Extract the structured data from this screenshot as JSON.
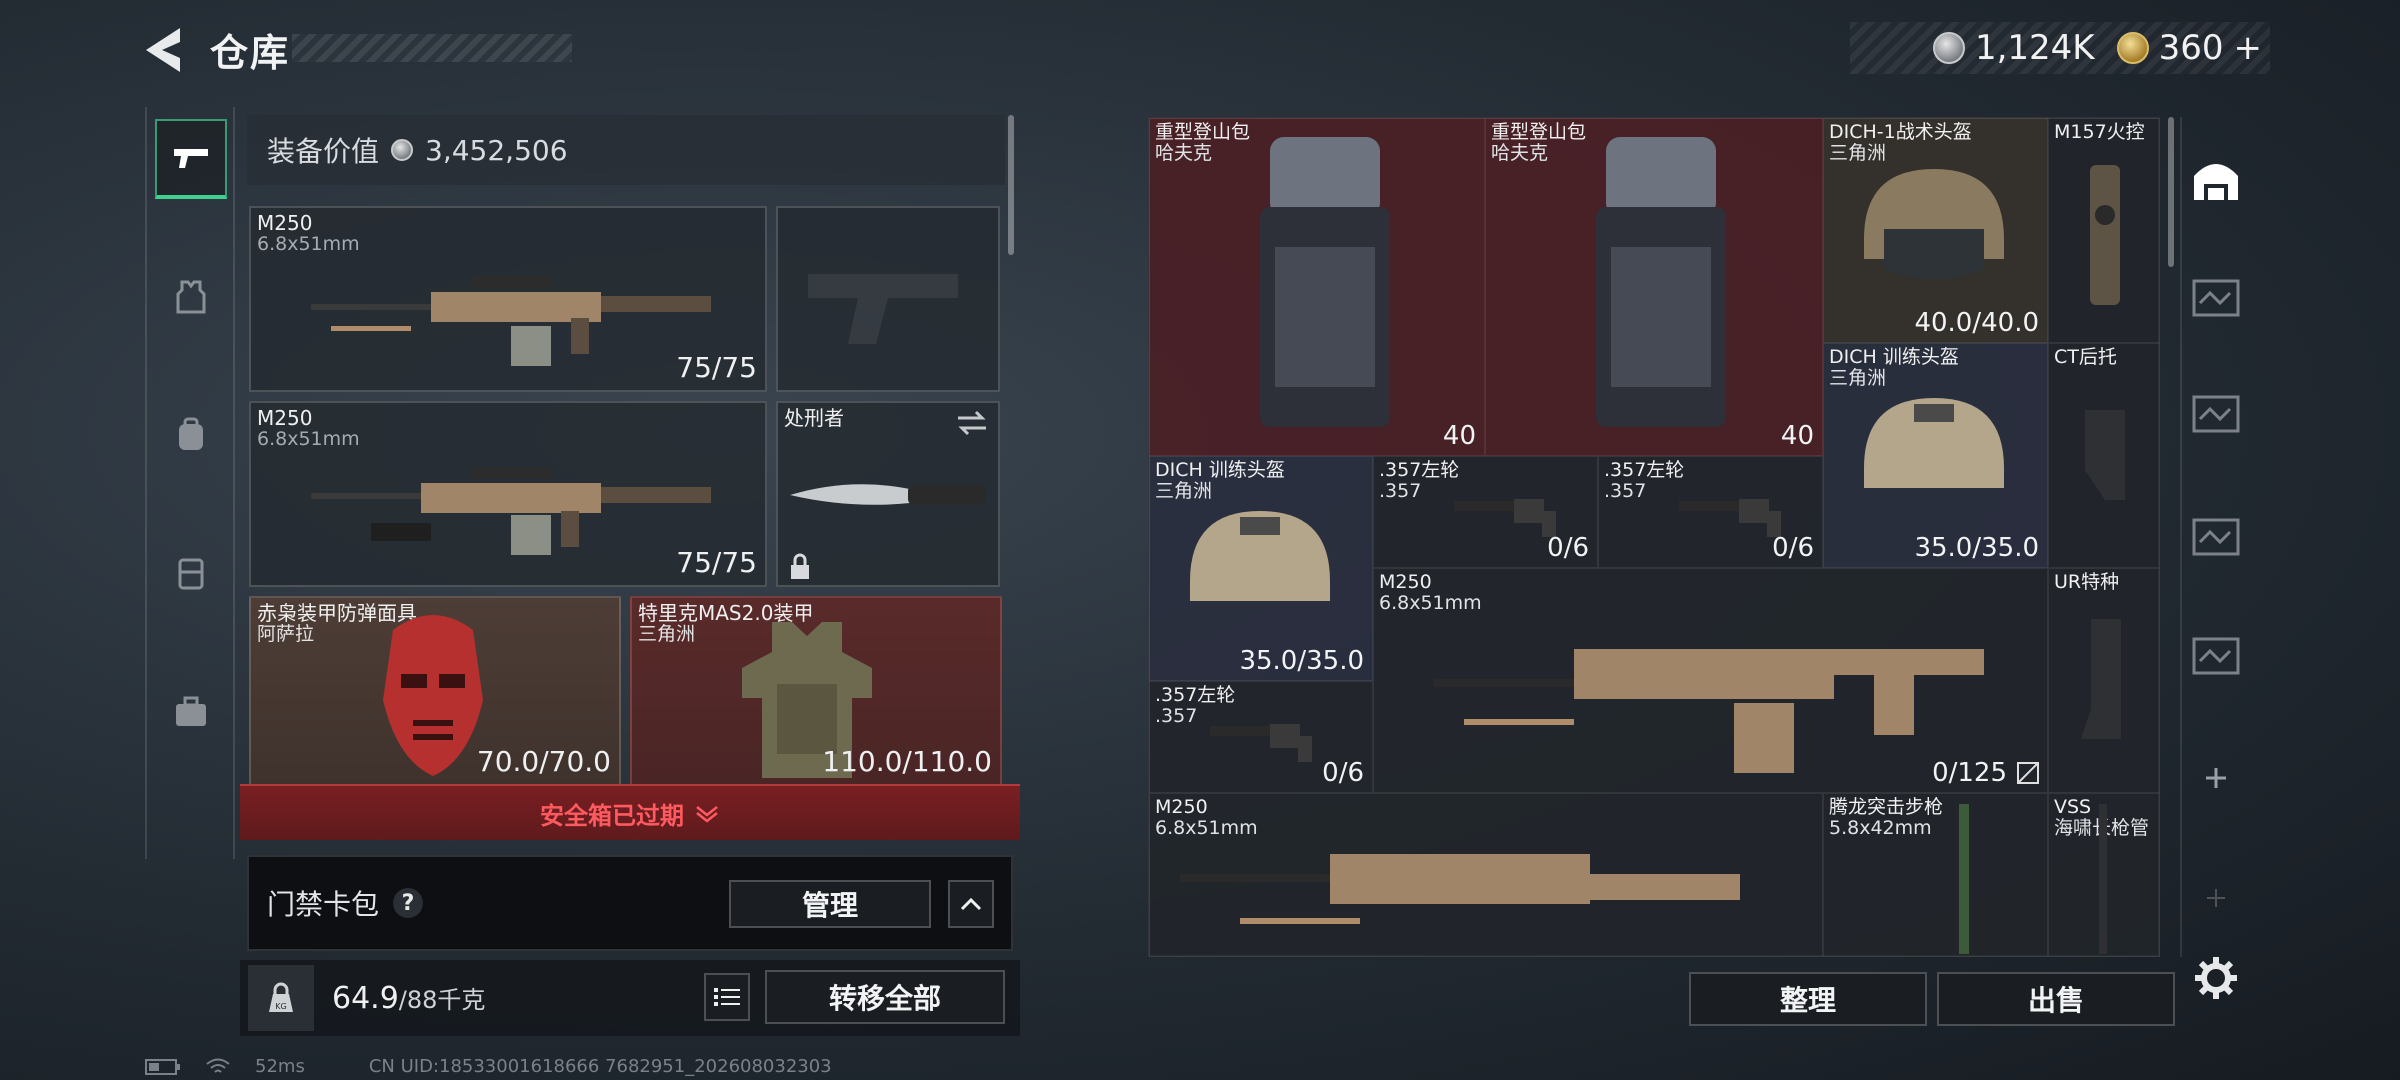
{
  "header": {
    "title": "仓库"
  },
  "currency": [
    {
      "value": "1,124K",
      "icon": "silver-coin-icon",
      "color": "#c7cacd"
    },
    {
      "value": "360",
      "icon": "gold-coin-icon",
      "color": "#d9bd69",
      "plus": "+"
    }
  ],
  "left": {
    "equip_value_label": "装备价值",
    "equip_value": "3,452,506",
    "slots": [
      {
        "name": "M250",
        "sub": "6.8x51mm",
        "value": "75/75"
      },
      {
        "name": "M250",
        "sub": "6.8x51mm",
        "value": "75/75"
      },
      {
        "name": "处刑者"
      },
      {
        "name": "赤枭装甲防弹面具",
        "sub": "阿萨拉",
        "value": "70.0/70.0"
      },
      {
        "name": "特里克MAS2.0装甲",
        "sub": "三角洲",
        "value": "110.0/110.0"
      }
    ],
    "expired": "安全箱已过期",
    "card_pack": "门禁卡包",
    "help": "?",
    "manage": "管理",
    "weight": "64.9",
    "weight_max": "/88千克",
    "transfer_all": "转移全部",
    "kg_label": "KG"
  },
  "grid": {
    "items": [
      {
        "name": "重型登山包",
        "sub": "哈夫克",
        "value": "40"
      },
      {
        "name": "重型登山包",
        "sub": "哈夫克",
        "value": "40"
      },
      {
        "name": "DICH-1战术头盔",
        "sub": "三角洲",
        "value": "40.0/40.0"
      },
      {
        "name": "M157火控"
      },
      {
        "name": "DICH 训练头盔",
        "sub": "三角洲",
        "value": "35.0/35.0"
      },
      {
        "name": "CT后托"
      },
      {
        "name": "DICH 训练头盔",
        "sub": "三角洲",
        "value": "35.0/35.0"
      },
      {
        "name": ".357左轮",
        "sub": ".357",
        "value": "0/6"
      },
      {
        "name": ".357左轮",
        "sub": ".357",
        "value": "0/6"
      },
      {
        "name": "M250",
        "sub": "6.8x51mm",
        "value": "0/125"
      },
      {
        "name": "UR特种"
      },
      {
        "name": ".357左轮",
        "sub": ".357",
        "value": "0/6"
      },
      {
        "name": "M250",
        "sub": "6.8x51mm"
      },
      {
        "name": "腾龙突击步枪",
        "sub": "5.8x42mm"
      },
      {
        "name": "VSS",
        "sub": "海啸长枪管"
      }
    ],
    "sort": "整理",
    "sell": "出售"
  },
  "status_bar": {
    "ping": "52ms",
    "uid": "CN UID:18533001618666 7682951_202608032303"
  }
}
